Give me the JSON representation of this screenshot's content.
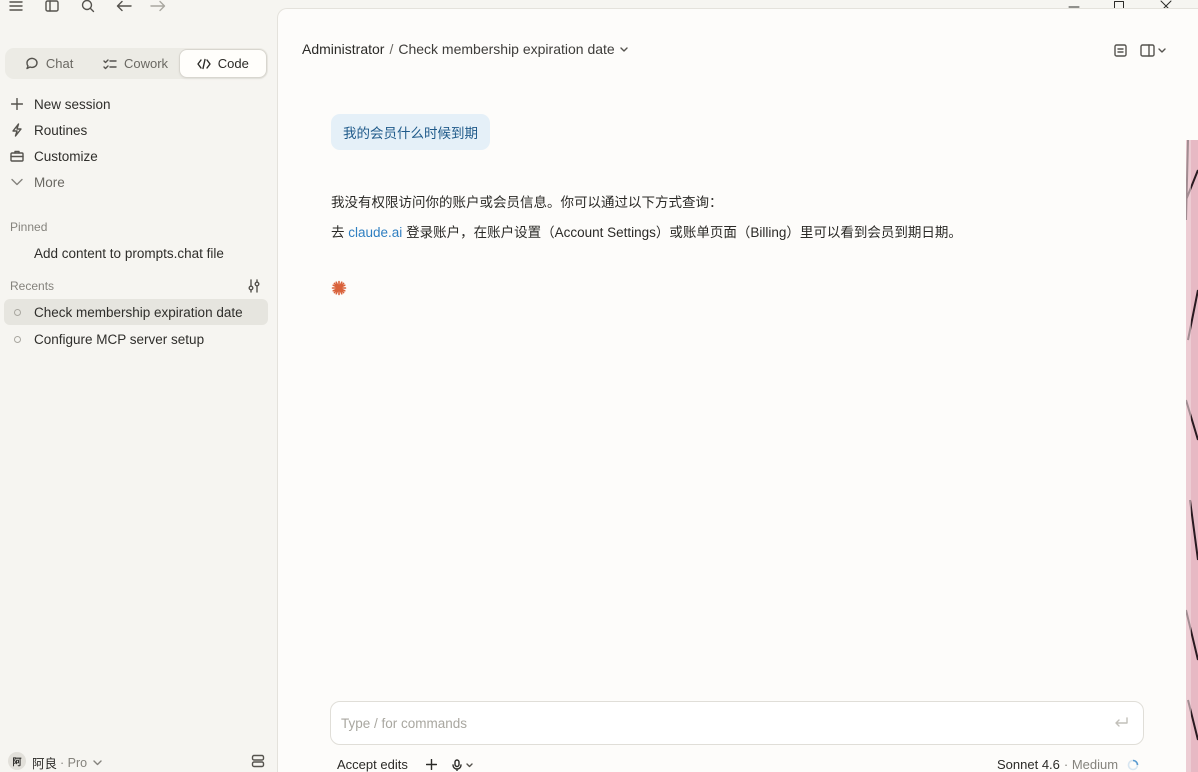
{
  "titlebar": {
    "icons": [
      "menu-icon",
      "sidebar-toggle-icon",
      "search-icon",
      "back-arrow-icon",
      "forward-arrow-icon"
    ],
    "window_controls": [
      "minimize-icon",
      "maximize-icon",
      "close-icon"
    ]
  },
  "sidebar": {
    "mode_tabs": [
      {
        "label": "Chat",
        "icon": "chat-bubble-icon",
        "active": false
      },
      {
        "label": "Cowork",
        "icon": "checklist-icon",
        "active": false
      },
      {
        "label": "Code",
        "icon": "code-icon",
        "active": true
      }
    ],
    "nav": [
      {
        "label": "New session",
        "icon": "plus-icon"
      },
      {
        "label": "Routines",
        "icon": "lightning-icon"
      },
      {
        "label": "Customize",
        "icon": "briefcase-icon"
      },
      {
        "label": "More",
        "icon": "chevron-down-icon"
      }
    ],
    "pinned_label": "Pinned",
    "pinned": [
      {
        "label": "Add content to prompts.chat file"
      }
    ],
    "recents_label": "Recents",
    "recents": [
      {
        "label": "Check membership expiration date",
        "active": true
      },
      {
        "label": "Configure MCP server setup",
        "active": false
      }
    ],
    "footer": {
      "avatar_text": "阿",
      "user_name": "阿良",
      "plan": "· Pro"
    }
  },
  "header": {
    "breadcrumb_root": "Administrator",
    "separator": "/",
    "current": "Check membership expiration date"
  },
  "conversation": {
    "user_message": "我的会员什么时候到期",
    "assistant_line1": "我没有权限访问你的账户或会员信息。你可以通过以下方式查询：",
    "assistant_line2_prefix": "去 ",
    "assistant_link": "claude.ai",
    "assistant_line2_suffix": " 登录账户，在账户设置（Account Settings）或账单页面（Billing）里可以看到会员到期日期。"
  },
  "composer": {
    "placeholder": "Type / for commands"
  },
  "toolbar": {
    "accept_edits": "Accept edits",
    "model": "Sonnet 4.6",
    "effort": "· Medium"
  },
  "colors": {
    "accent_link": "#2f7fc1",
    "user_bubble_bg": "#e5f0f8",
    "spark": "#d9623b"
  }
}
